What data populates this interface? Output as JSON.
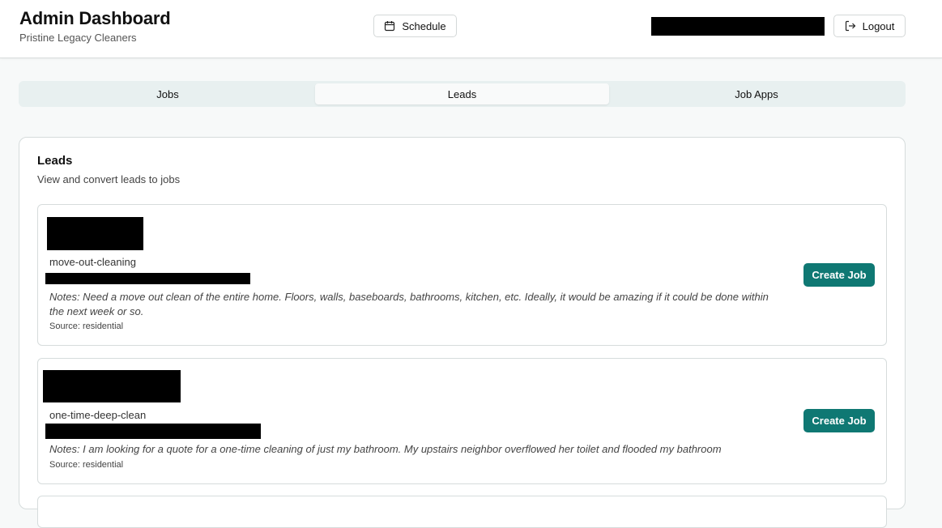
{
  "header": {
    "title": "Admin Dashboard",
    "subtitle": "Pristine Legacy Cleaners",
    "schedule_label": "Schedule",
    "logout_label": "Logout"
  },
  "tabs": [
    {
      "label": "Jobs"
    },
    {
      "label": "Leads"
    },
    {
      "label": "Job Apps"
    }
  ],
  "leads_card": {
    "title": "Leads",
    "description": "View and convert leads to jobs"
  },
  "leads": [
    {
      "service": "move-out-cleaning",
      "notes": "Notes: Need a move out clean of the entire home. Floors, walls, baseboards, bathrooms, kitchen, etc. Ideally, it would be amazing if it could be done within the next week or so.",
      "source": "Source: residential",
      "action_label": "Create Job"
    },
    {
      "service": "one-time-deep-clean",
      "notes": "Notes: I am looking for a quote for a one-time cleaning of just my bathroom. My upstairs neighbor overflowed her toilet and flooded my bathroom",
      "source": "Source: residential",
      "action_label": "Create Job"
    }
  ],
  "colors": {
    "accent": "#0f7873",
    "tab_bg": "#e8f0f0",
    "redaction": "#000000"
  },
  "icons": {
    "schedule": "calendar-icon",
    "logout": "logout-icon"
  }
}
